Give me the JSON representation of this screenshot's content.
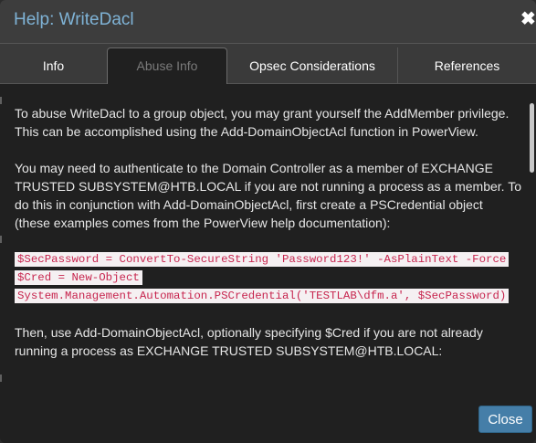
{
  "dialog": {
    "title": "Help: WriteDacl",
    "close_glyph": "✖"
  },
  "tabs": [
    {
      "label": "Info",
      "active": false
    },
    {
      "label": "Abuse Info",
      "active": true
    },
    {
      "label": "Opsec Considerations",
      "active": false
    },
    {
      "label": "References",
      "active": false
    }
  ],
  "content": {
    "p1": "To abuse WriteDacl to a group object, you may grant yourself the AddMember privilege. This can be accomplished using the Add-DomainObjectAcl function in PowerView.",
    "p2": "You may need to authenticate to the Domain Controller as a member of EXCHANGE TRUSTED SUBSYSTEM@HTB.LOCAL if you are not running a process as a member. To do this in conjunction with Add-DomainObjectAcl, first create a PSCredential object (these examples comes from the PowerView help documentation):",
    "code_lines": [
      "$SecPassword = ConvertTo-SecureString 'Password123!' -AsPlainText -Force",
      "$Cred = New-Object",
      "System.Management.Automation.PSCredential('TESTLAB\\dfm.a', $SecPassword)"
    ],
    "p3": "Then, use Add-DomainObjectAcl, optionally specifying $Cred if you are not already running a process as EXCHANGE TRUSTED SUBSYSTEM@HTB.LOCAL:"
  },
  "footer": {
    "close_label": "Close"
  },
  "colors": {
    "title": "#7fb3d6",
    "code_text": "#c7254e",
    "code_bg": "#f5f0f2",
    "button_bg": "#457ea8"
  }
}
